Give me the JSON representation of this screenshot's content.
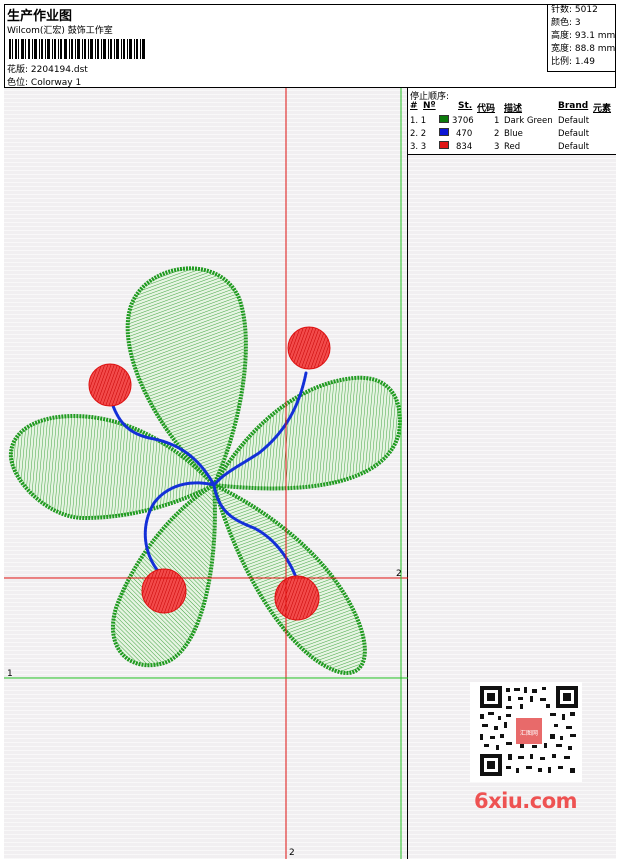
{
  "header": {
    "title": "生产作业图",
    "studio": "Wilcom(汇宏) 鼓饰工作室",
    "design_label": "花版:",
    "design_value": "2204194.dst",
    "color_label": "色位:",
    "color_value": "Colorway 1"
  },
  "info": {
    "stitches": "针数: 5012",
    "colors": "颜色: 3",
    "height": "高度: 93.1 mm",
    "width": "宽度: 88.8 mm",
    "scale": "比例: 1.49"
  },
  "stops": {
    "title": "停止顺序:",
    "headers": [
      "#",
      "Nº",
      "St.",
      "代码",
      "描述",
      "Brand",
      "元素"
    ],
    "rows": [
      {
        "num": "1. 1",
        "color": "#0b7a0b",
        "st": "3706",
        "code": "1",
        "desc": "Dark Green",
        "brand": "Default"
      },
      {
        "num": "2. 2",
        "color": "#0b15d6",
        "st": "470",
        "code": "2",
        "desc": "Blue",
        "brand": "Default"
      },
      {
        "num": "3. 3",
        "color": "#e01818",
        "st": "834",
        "code": "3",
        "desc": "Red",
        "brand": "Default"
      }
    ]
  },
  "markers": {
    "bottom_2": "2",
    "right_2": "2",
    "left_1": "1"
  },
  "watermark": "6xiu.com",
  "qr_stamp": "汇图网"
}
